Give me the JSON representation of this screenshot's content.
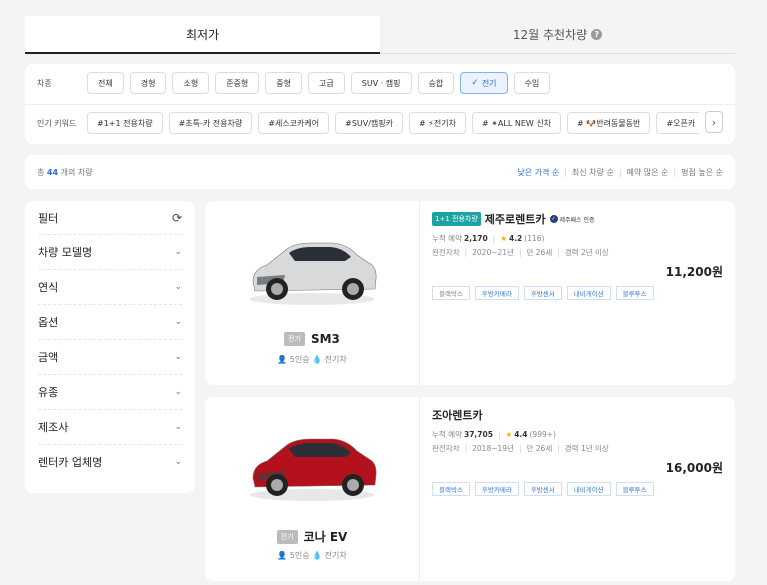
{
  "tabs": [
    {
      "label": "최저가",
      "active": true
    },
    {
      "label": "12월 추천차량",
      "active": false
    }
  ],
  "filters": {
    "cartype_label": "차종",
    "cartypes": [
      "전체",
      "경형",
      "소형",
      "준중형",
      "중형",
      "고급",
      "SUV · 캠핑",
      "승합",
      "전기",
      "수입"
    ],
    "cartype_selected": "전기",
    "keyword_label": "인기 키워드",
    "keywords": [
      "#1+1 전용차량",
      "#초특-카 전용차량",
      "#세스코카케어",
      "#SUV/캠핑카",
      "# ⚡전기차",
      "# ✴ALL NEW 신차",
      "# 🐶반려동물동반",
      "#오픈카"
    ],
    "next_icon": "chevron-right-icon"
  },
  "sort": {
    "count_prefix": "총",
    "count": "44",
    "count_suffix": "개의 차량",
    "options": [
      "낮은 가격 순",
      "최신 차량 순",
      "예약 많은 순",
      "평점 높은 순"
    ],
    "selected": "낮은 가격 순"
  },
  "sidebar": {
    "title": "필터",
    "items": [
      "차량 모델명",
      "연식",
      "옵션",
      "금액",
      "유종",
      "제조사",
      "렌터카 업체명"
    ]
  },
  "cars": [
    {
      "ev_tag": "전기",
      "model": "SM3",
      "seats": "5인승",
      "fuel": "전기차",
      "badge": "1+1 전용차량",
      "company": "제주로렌트카",
      "jeju_badge": "제주패스 인증",
      "reservations_label": "누적 예약",
      "reservations": "2,170",
      "rating": "4.2",
      "reviews": "(116)",
      "insurance_label": "완전자차",
      "years": "2020~21년",
      "age_limit": "만 26세",
      "license": "경력 2년 이상",
      "price": "11,200원",
      "options": [
        {
          "label": "블랙박스",
          "gray": true
        },
        {
          "label": "후방카메라",
          "gray": false
        },
        {
          "label": "후방센서",
          "gray": false
        },
        {
          "label": "내비게이션",
          "gray": false
        },
        {
          "label": "블루투스",
          "gray": false
        }
      ],
      "car_color": "#d8d9db"
    },
    {
      "ev_tag": "전기",
      "model": "코나 EV",
      "seats": "5인승",
      "fuel": "전기차",
      "badge": "",
      "company": "조아렌트카",
      "jeju_badge": "",
      "reservations_label": "누적 예약",
      "reservations": "37,705",
      "rating": "4.4",
      "reviews": "(999+)",
      "insurance_label": "완전자차",
      "years": "2018~19년",
      "age_limit": "만 26세",
      "license": "경력 1년 이상",
      "price": "16,000원",
      "options": [
        {
          "label": "블랙박스",
          "gray": false
        },
        {
          "label": "후방카메라",
          "gray": false
        },
        {
          "label": "후방센서",
          "gray": false
        },
        {
          "label": "내비게이션",
          "gray": false
        },
        {
          "label": "블루투스",
          "gray": false
        }
      ],
      "car_color": "#b3121c"
    }
  ]
}
